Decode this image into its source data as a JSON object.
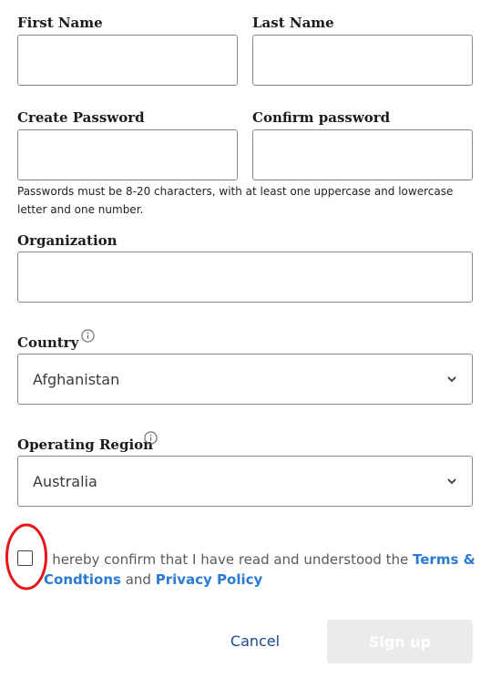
{
  "fields": {
    "first_name": {
      "label": "First Name",
      "value": ""
    },
    "last_name": {
      "label": "Last Name",
      "value": ""
    },
    "create_password": {
      "label": "Create Password",
      "value": ""
    },
    "confirm_password": {
      "label": "Confirm password",
      "value": ""
    },
    "password_hint": "Passwords must be 8-20 characters, with at least one uppercase and lowercase letter and one number.",
    "organization": {
      "label": "Organization",
      "value": ""
    },
    "country": {
      "label": "Country",
      "value": "Afghanistan"
    },
    "operating_region": {
      "label": "Operating Region",
      "value": "Australia"
    }
  },
  "consent": {
    "checked": false,
    "text_before": "I hereby confirm that I have read and understood the ",
    "terms_link": "Terms & Condtions",
    "and": " and ",
    "privacy_link": "Privacy Policy"
  },
  "actions": {
    "cancel_label": "Cancel",
    "signup_label": "Sign up"
  },
  "colors": {
    "link": "#2a7ad6",
    "cancel": "#21488c",
    "signup_disabled_bg": "#ebebeb",
    "annotation_circle": "#e8151b"
  },
  "icons": {
    "info": "info-circle-icon",
    "chevron": "chevron-down-icon"
  }
}
